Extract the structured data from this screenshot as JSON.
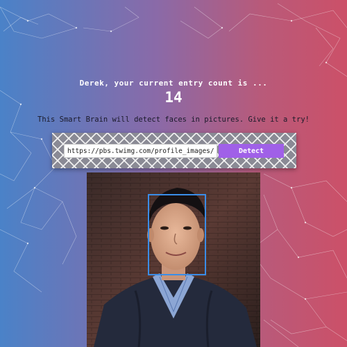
{
  "header": {
    "greeting": "Derek, your current entry count is ...",
    "entry_count": "14"
  },
  "tagline": "This Smart Brain will detect faces in pictures. Give it a try!",
  "form": {
    "image_url": "https://pbs.twimg.com/profile_images/10",
    "detect_label": "Detect"
  },
  "colors": {
    "bg_left": "#4a82c8",
    "bg_right": "#cc5068",
    "detect_button": "#a060e8",
    "face_box": "#3a8de8"
  },
  "image": {
    "description_icon": "portrait-photo",
    "faces_detected": 1
  }
}
